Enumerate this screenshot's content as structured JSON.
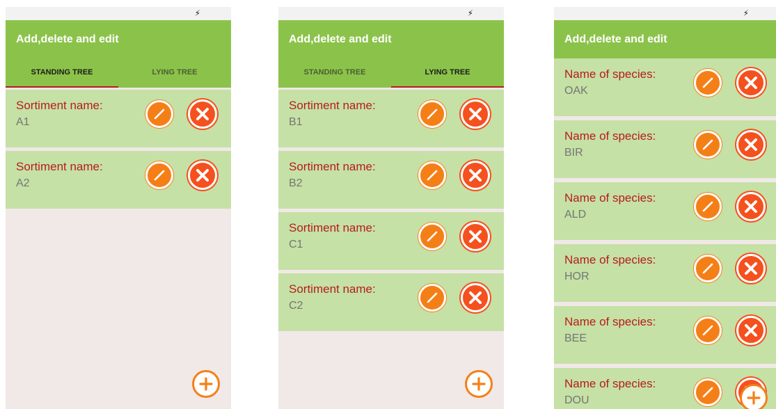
{
  "colors": {
    "appbar": "#8bc34a",
    "card": "#c5e1a5",
    "label": "#b71c1c",
    "value": "#757575",
    "accent": "#f57f17",
    "delete": "#f4511e"
  },
  "icons": {
    "status": "charging-bolt-icon",
    "edit": "edit-pencil-icon",
    "delete": "close-icon",
    "add": "plus-icon"
  },
  "status_glyph": "⚡",
  "screen1": {
    "title": "Add,delete and edit",
    "tabs": [
      {
        "label": "STANDING TREE",
        "active": true
      },
      {
        "label": "LYING TREE",
        "active": false
      }
    ],
    "items": [
      {
        "label": "Sortiment name:",
        "value": "A1"
      },
      {
        "label": "Sortiment name:",
        "value": "A2"
      }
    ]
  },
  "screen2": {
    "title": "Add,delete and edit",
    "tabs": [
      {
        "label": "STANDING TREE",
        "active": false
      },
      {
        "label": "LYING TREE",
        "active": true
      }
    ],
    "items": [
      {
        "label": "Sortiment name:",
        "value": "B1"
      },
      {
        "label": "Sortiment name:",
        "value": "B2"
      },
      {
        "label": "Sortiment name:",
        "value": "C1"
      },
      {
        "label": "Sortiment name:",
        "value": "C2"
      }
    ]
  },
  "screen3": {
    "title": "Add,delete and edit",
    "items": [
      {
        "label": "Name of species:",
        "value": "OAK"
      },
      {
        "label": "Name of species:",
        "value": "BIR"
      },
      {
        "label": "Name of species:",
        "value": "ALD"
      },
      {
        "label": "Name of species:",
        "value": "HOR"
      },
      {
        "label": "Name of species:",
        "value": "BEE"
      },
      {
        "label": "Name of species:",
        "value": "DOU"
      }
    ]
  }
}
